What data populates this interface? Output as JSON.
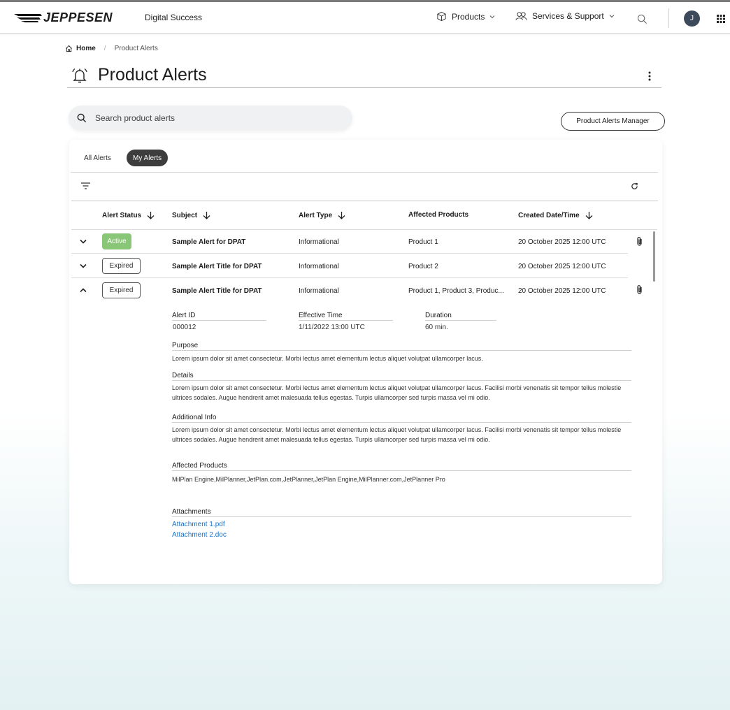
{
  "header": {
    "logo_text": "JEPPESEN",
    "brand_sub": "Digital Success",
    "nav_products": "Products",
    "nav_services": "Services & Support",
    "avatar_initial": "J"
  },
  "breadcrumb": {
    "home": "Home",
    "current": "Product Alerts"
  },
  "page": {
    "title": "Product Alerts"
  },
  "search": {
    "placeholder": "Search product alerts"
  },
  "manager_button": "Product Alerts Manager",
  "tabs": {
    "all": "All Alerts",
    "my": "My Alerts"
  },
  "columns": {
    "status": "Alert Status",
    "subject": "Subject",
    "type": "Alert Type",
    "products": "Affected Products",
    "created": "Created Date/Time"
  },
  "rows": [
    {
      "status": "Active",
      "subject": "Sample Alert for DPAT",
      "type": "Informational",
      "products": "Product 1",
      "created": "20 October 2025 12:00 UTC"
    },
    {
      "status": "Expired",
      "subject": "Sample Alert Title for DPAT",
      "type": "Informational",
      "products": "Product 2",
      "created": "20 October 2025 12:00 UTC"
    },
    {
      "status": "Expired",
      "subject": "Sample Alert Title for DPAT",
      "type": "Informational",
      "products": "Product 1, Product 3, Produc...",
      "created": "20 October 2025 12:00 UTC"
    }
  ],
  "detail": {
    "alert_id_label": "Alert ID",
    "alert_id": "000012",
    "effective_label": "Effective Time",
    "effective": "1/11/2022 13:00 UTC",
    "duration_label": "Duration",
    "duration": "60 min.",
    "purpose_label": "Purpose",
    "purpose": "Lorem ipsum dolor sit amet consectetur. Morbi lectus amet elementum lectus aliquet volutpat ullamcorper lacus.",
    "details_label": "Details",
    "details": "Lorem ipsum dolor sit amet consectetur. Morbi lectus amet elementum lectus aliquet volutpat ullamcorper lacus. Facilisi morbi venenatis sit tempor tellus molestie ultrices sodales. Augue hendrerit amet malesuada tellus egestas. Turpis ullamcorper sed turpis massa vel mi odio.",
    "additional_label": "Additional Info",
    "additional": "Lorem ipsum dolor sit amet consectetur. Morbi lectus amet elementum lectus aliquet volutpat ullamcorper lacus. Facilisi morbi venenatis sit tempor tellus molestie ultrices sodales. Augue hendrerit amet malesuada tellus egestas. Turpis ullamcorper sed turpis massa vel mi odio.",
    "affected_label": "Affected Products",
    "affected": "MilPlan Engine,MilPlanner,JetPlan.com,JetPlanner,JetPlan Engine,MilPlanner.com,JetPlanner Pro",
    "attachments_label": "Attachments",
    "attachment_1": "Attachment 1.pdf",
    "attachment_2": "Attachment 2.doc"
  },
  "colors": {
    "active": "#8ac678",
    "link": "#1a73c9",
    "tab_selected": "#3d3d3d",
    "avatar": "#3c4a5c"
  }
}
